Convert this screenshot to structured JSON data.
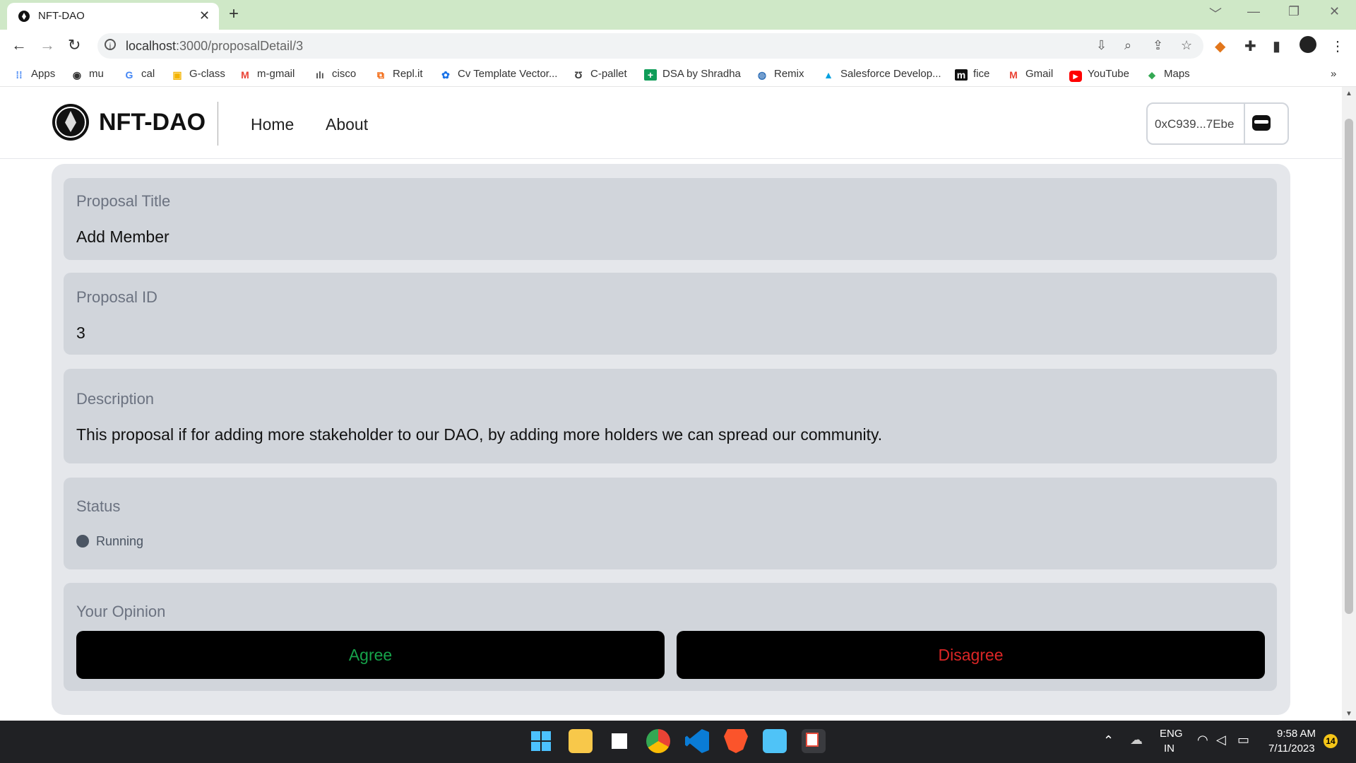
{
  "browser": {
    "tab_title": "NFT-DAO",
    "url_host": "localhost",
    "url_rest": ":3000/proposalDetail/3",
    "bookmarks": [
      "Apps",
      "mu",
      "cal",
      "G-class",
      "m-gmail",
      "cisco",
      "Repl.it",
      "Cv Template Vector...",
      "C-pallet",
      "DSA by Shradha",
      "Remix",
      "Salesforce Develop...",
      "fice",
      "Gmail",
      "YouTube",
      "Maps"
    ]
  },
  "nav": {
    "logo_text": "NFT-DAO",
    "links": [
      "Home",
      "About"
    ],
    "wallet_address": "0xC939...7Ebe"
  },
  "proposal": {
    "title_label": "Proposal Title",
    "title_value": "Add Member",
    "id_label": "Proposal ID",
    "id_value": "3",
    "description_label": "Description",
    "description_value": "This proposal if for adding more stakeholder to our DAO, by adding more holders we can spread our community.",
    "status_label": "Status",
    "status_value": "Running",
    "opinion_label": "Your Opinion",
    "agree_label": "Agree",
    "disagree_label": "Disagree"
  },
  "colors": {
    "agree": "#16a34a",
    "disagree": "#dc2626",
    "card_bg": "#e5e7eb",
    "field_bg": "#d1d5db",
    "tab_bar": "#cfe8c7"
  },
  "taskbar": {
    "lang_top": "ENG",
    "lang_bottom": "IN",
    "time": "9:58 AM",
    "date": "7/11/2023",
    "notification_count": "14"
  }
}
